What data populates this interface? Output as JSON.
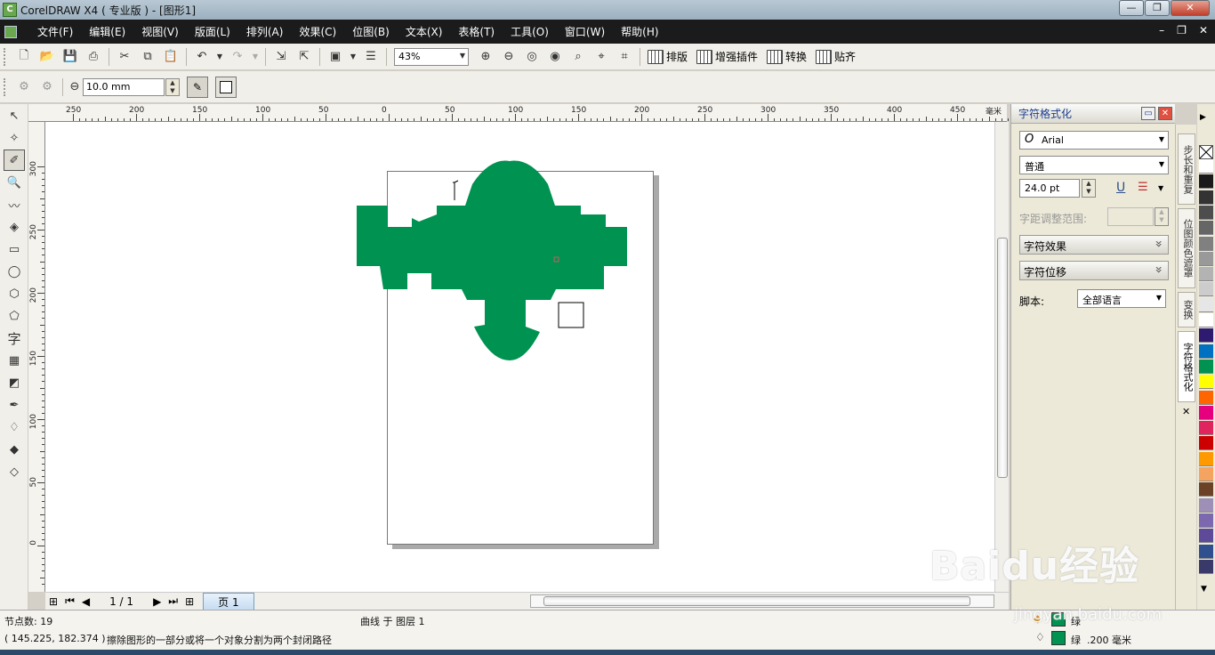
{
  "window": {
    "title": "CorelDRAW X4 ( 专业版 ) - [图形1]"
  },
  "menu": [
    "文件(F)",
    "编辑(E)",
    "视图(V)",
    "版面(L)",
    "排列(A)",
    "效果(C)",
    "位图(B)",
    "文本(X)",
    "表格(T)",
    "工具(O)",
    "窗口(W)",
    "帮助(H)"
  ],
  "toolbar": {
    "zoom": "43%",
    "text_buttons": [
      "排版",
      "增强插件",
      "转换",
      "贴齐"
    ]
  },
  "property_bar": {
    "width_value": "10.0 mm"
  },
  "ruler": {
    "top_labels": [
      "250",
      "200",
      "150",
      "100",
      "50",
      "0",
      "50",
      "100",
      "150",
      "200",
      "250",
      "300",
      "350",
      "400",
      "450"
    ],
    "top_unit": "毫米",
    "left_labels": [
      "300",
      "250",
      "200",
      "150",
      "100",
      "50",
      "0"
    ]
  },
  "pager": {
    "count": "1 / 1",
    "tab": "页 1"
  },
  "docker": {
    "title": "字符格式化",
    "font": "Arial",
    "style": "普通",
    "size": "24.0 pt",
    "range_label": "字距调整范围:",
    "section_effects": "字符效果",
    "section_shift": "字符位移",
    "script_label": "脚本:",
    "script_value": "全部语言",
    "tabs": [
      "步长和重复",
      "位图颜色遮罩",
      "变换",
      "字符格式化"
    ]
  },
  "palette_colors": [
    "#ffffff",
    "#1a1a1a",
    "#333333",
    "#4d4d4d",
    "#666666",
    "#808080",
    "#999999",
    "#b3b3b3",
    "#cccccc",
    "#e6e6e6",
    "#ffffff",
    "#2e1a6e",
    "#0070c0",
    "#009250",
    "#ffff00",
    "#ff6600",
    "#e6007e",
    "#e0245e",
    "#cc0000",
    "#ff9900",
    "#f4a460",
    "#6b4226",
    "#9e8fb6",
    "#7b68ae",
    "#5e4a99",
    "#2f4f8f",
    "#3a3a6a"
  ],
  "status": {
    "nodes": "节点数: 19",
    "object": "曲线 于 图层 1",
    "coords": "( 145.225, 182.374 )",
    "hint": "擦除图形的一部分或将一个对象分割为两个封闭路径",
    "fill_label": "绿",
    "outline_label": "绿",
    "outline_width": ".200 毫米",
    "fill_color": "#009250"
  },
  "shape_color": "#009250",
  "watermark": "Baidu经验",
  "watermark_url": "jingyan.baidu.com"
}
